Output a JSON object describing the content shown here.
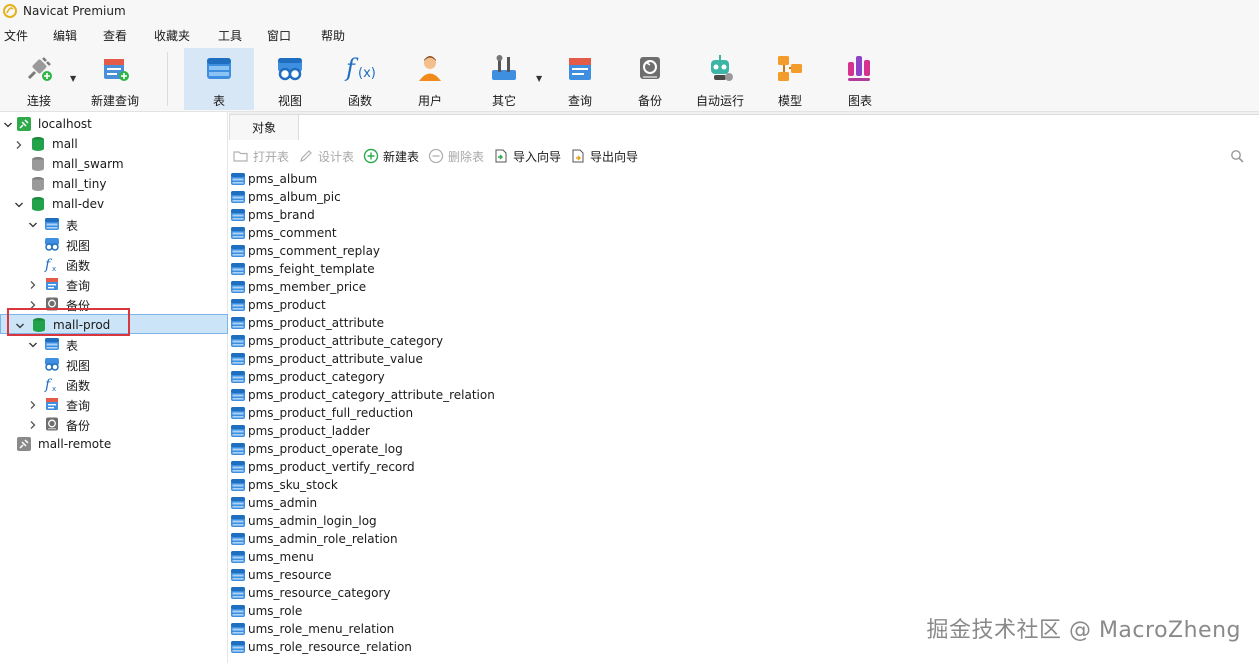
{
  "window": {
    "title": "Navicat Premium"
  },
  "menu": [
    "文件",
    "编辑",
    "查看",
    "收藏夹",
    "工具",
    "窗口",
    "帮助"
  ],
  "toolbar": [
    {
      "id": "connect",
      "label": "连接",
      "icon": "plug-icon",
      "caret": true
    },
    {
      "id": "new-query",
      "label": "新建查询",
      "icon": "new-query-icon"
    },
    {
      "id": "table",
      "label": "表",
      "icon": "table-icon",
      "active": true
    },
    {
      "id": "view",
      "label": "视图",
      "icon": "view-icon"
    },
    {
      "id": "function",
      "label": "函数",
      "icon": "function-icon"
    },
    {
      "id": "user",
      "label": "用户",
      "icon": "user-icon"
    },
    {
      "id": "other",
      "label": "其它",
      "icon": "tools-icon",
      "caret": true
    },
    {
      "id": "query",
      "label": "查询",
      "icon": "query-icon"
    },
    {
      "id": "backup",
      "label": "备份",
      "icon": "backup-icon"
    },
    {
      "id": "automation",
      "label": "自动运行",
      "icon": "robot-icon"
    },
    {
      "id": "model",
      "label": "模型",
      "icon": "model-icon"
    },
    {
      "id": "chart",
      "label": "图表",
      "icon": "chart-icon"
    }
  ],
  "tree": [
    {
      "label": "localhost",
      "icon": "connection-icon",
      "level": 0,
      "arrow": "down"
    },
    {
      "label": "mall",
      "icon": "database-green-icon",
      "level": 1,
      "arrow": "right"
    },
    {
      "label": "mall_swarm",
      "icon": "database-gray-icon",
      "level": 1,
      "arrow": ""
    },
    {
      "label": "mall_tiny",
      "icon": "database-gray-icon",
      "level": 1,
      "arrow": ""
    },
    {
      "label": "mall-dev",
      "icon": "database-green-icon",
      "level": 1,
      "arrow": "down"
    },
    {
      "label": "表",
      "icon": "table-icon",
      "level": 2,
      "arrow": "down"
    },
    {
      "label": "视图",
      "icon": "view-icon",
      "level": 2,
      "arrow": ""
    },
    {
      "label": "函数",
      "icon": "function-icon",
      "level": 2,
      "arrow": ""
    },
    {
      "label": "查询",
      "icon": "query-icon",
      "level": 2,
      "arrow": "right"
    },
    {
      "label": "备份",
      "icon": "backup-icon",
      "level": 2,
      "arrow": "right"
    },
    {
      "label": "mall-prod",
      "icon": "database-green-icon",
      "level": 1,
      "arrow": "down",
      "selected": true
    },
    {
      "label": "表",
      "icon": "table-icon",
      "level": 2,
      "arrow": "down"
    },
    {
      "label": "视图",
      "icon": "view-icon",
      "level": 2,
      "arrow": ""
    },
    {
      "label": "函数",
      "icon": "function-icon",
      "level": 2,
      "arrow": ""
    },
    {
      "label": "查询",
      "icon": "query-icon",
      "level": 2,
      "arrow": "right"
    },
    {
      "label": "备份",
      "icon": "backup-icon",
      "level": 2,
      "arrow": "right"
    },
    {
      "label": "mall-remote",
      "icon": "connection-gray-icon",
      "level": 0,
      "arrow": ""
    }
  ],
  "tabs": {
    "objects": "对象"
  },
  "object_toolbar": [
    {
      "id": "open-table",
      "label": "打开表",
      "icon": "folder-icon",
      "disabled": true
    },
    {
      "id": "design-table",
      "label": "设计表",
      "icon": "pencil-icon",
      "disabled": true
    },
    {
      "id": "new-table",
      "label": "新建表",
      "icon": "add-icon",
      "disabled": false
    },
    {
      "id": "delete-table",
      "label": "删除表",
      "icon": "remove-icon",
      "disabled": true
    },
    {
      "id": "import-wizard",
      "label": "导入向导",
      "icon": "import-icon",
      "disabled": false
    },
    {
      "id": "export-wizard",
      "label": "导出向导",
      "icon": "export-icon",
      "disabled": false
    }
  ],
  "tables": [
    "pms_album",
    "pms_album_pic",
    "pms_brand",
    "pms_comment",
    "pms_comment_replay",
    "pms_feight_template",
    "pms_member_price",
    "pms_product",
    "pms_product_attribute",
    "pms_product_attribute_category",
    "pms_product_attribute_value",
    "pms_product_category",
    "pms_product_category_attribute_relation",
    "pms_product_full_reduction",
    "pms_product_ladder",
    "pms_product_operate_log",
    "pms_product_vertify_record",
    "pms_sku_stock",
    "ums_admin",
    "ums_admin_login_log",
    "ums_admin_role_relation",
    "ums_menu",
    "ums_resource",
    "ums_resource_category",
    "ums_role",
    "ums_role_menu_relation",
    "ums_role_resource_relation"
  ],
  "watermark": "掘金技术社区 @ MacroZheng",
  "colors": {
    "accent": "#2a7fd4",
    "selection": "#cce4f7",
    "highlight": "#d9363e",
    "db_green": "#1fa24a"
  }
}
